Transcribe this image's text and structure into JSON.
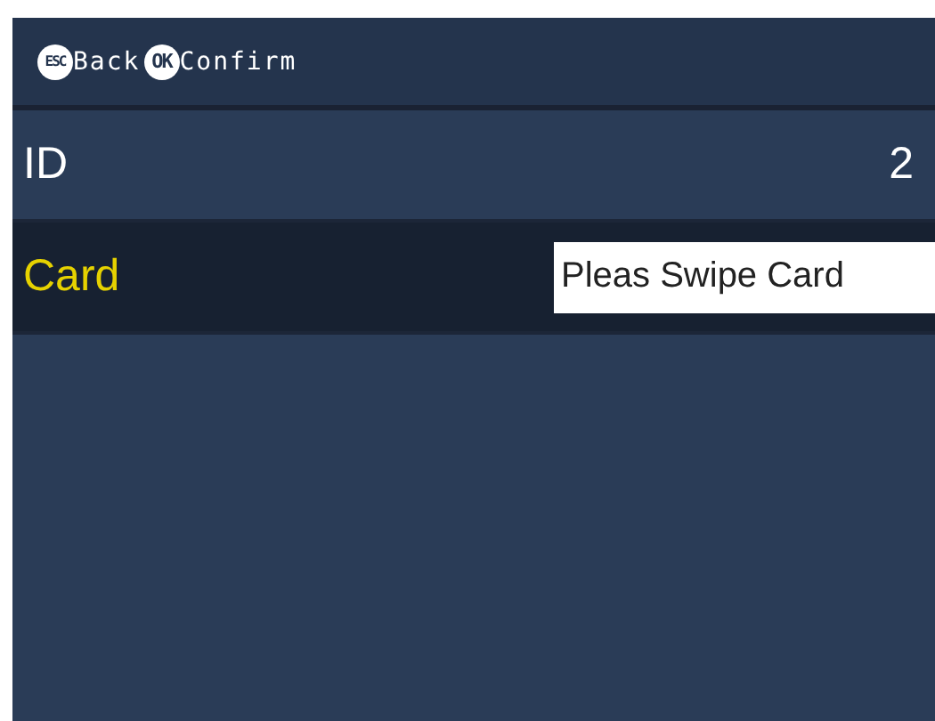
{
  "hints": [
    {
      "key": "ESC",
      "label": "Back"
    },
    {
      "key": "OK",
      "label": "Confirm"
    }
  ],
  "rows": [
    {
      "label": "ID",
      "kind": "value",
      "value": "2",
      "selected": false
    },
    {
      "label": "Card",
      "kind": "field",
      "value": "Pleas Swipe Card",
      "selected": true
    }
  ]
}
